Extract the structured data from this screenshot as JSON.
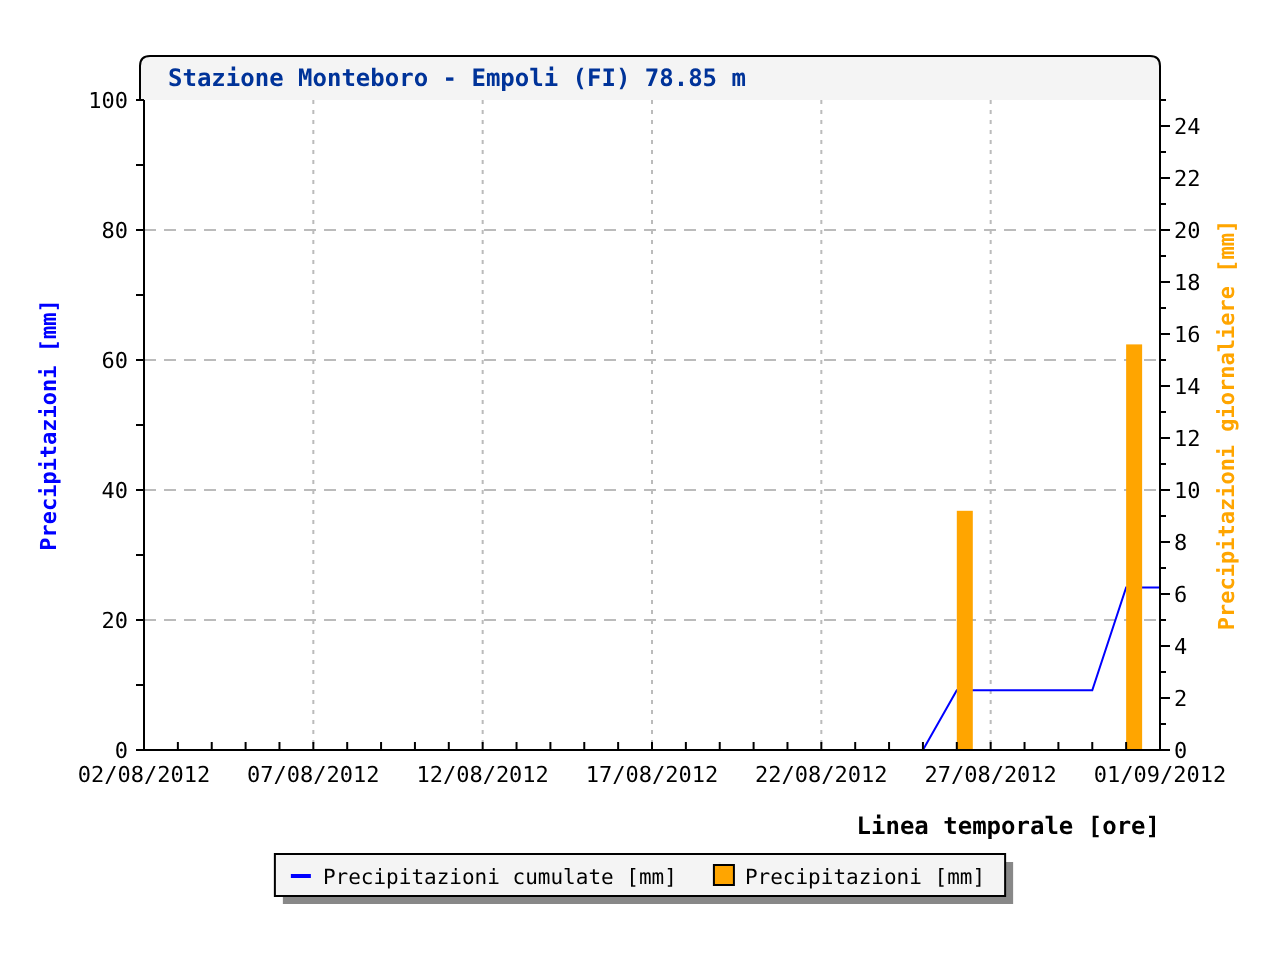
{
  "chart": {
    "chart_data": {
      "type": "line",
      "title": "Stazione Monteboro - Empoli (FI) 78.85 m",
      "xlabel": "Linea temporale [ore]",
      "ylabel": "Precipitazioni [mm]",
      "y2label": "Precipitazioni giornaliere [mm]",
      "categories": [
        "02/08/2012",
        null,
        null,
        null,
        null,
        "07/08/2012",
        null,
        null,
        null,
        null,
        "12/08/2012",
        null,
        null,
        null,
        null,
        "17/08/2012",
        null,
        null,
        null,
        null,
        "22/08/2012",
        null,
        null,
        null,
        null,
        "27/08/2012",
        null,
        null,
        null,
        null,
        "01/09/2012"
      ],
      "ylim": [
        0,
        100
      ],
      "y2lim": [
        0,
        25
      ],
      "grid": true,
      "legend": true,
      "yticks": [
        0,
        20,
        40,
        60,
        80,
        100
      ],
      "y2ticks": [
        0,
        2,
        4,
        6,
        8,
        10,
        12,
        14,
        16,
        18,
        20,
        22,
        24
      ],
      "series": [
        {
          "name": "Precipitazioni cumulate [mm]",
          "type": "line",
          "color": "#0000ff",
          "values": [
            null,
            null,
            null,
            null,
            null,
            null,
            null,
            null,
            null,
            null,
            null,
            null,
            null,
            null,
            null,
            null,
            null,
            null,
            null,
            null,
            null,
            null,
            null,
            0,
            9.2,
            9.2,
            9.2,
            9.2,
            9.2,
            25,
            25
          ]
        },
        {
          "name": "Precipitazioni [mm]",
          "type": "bar",
          "axis": "y2",
          "color": "#ffa500",
          "values": [
            null,
            null,
            null,
            null,
            null,
            null,
            null,
            null,
            null,
            null,
            null,
            null,
            null,
            null,
            null,
            null,
            null,
            null,
            null,
            null,
            null,
            null,
            null,
            null,
            9.2,
            null,
            null,
            null,
            null,
            15.6,
            null
          ]
        }
      ]
    }
  }
}
